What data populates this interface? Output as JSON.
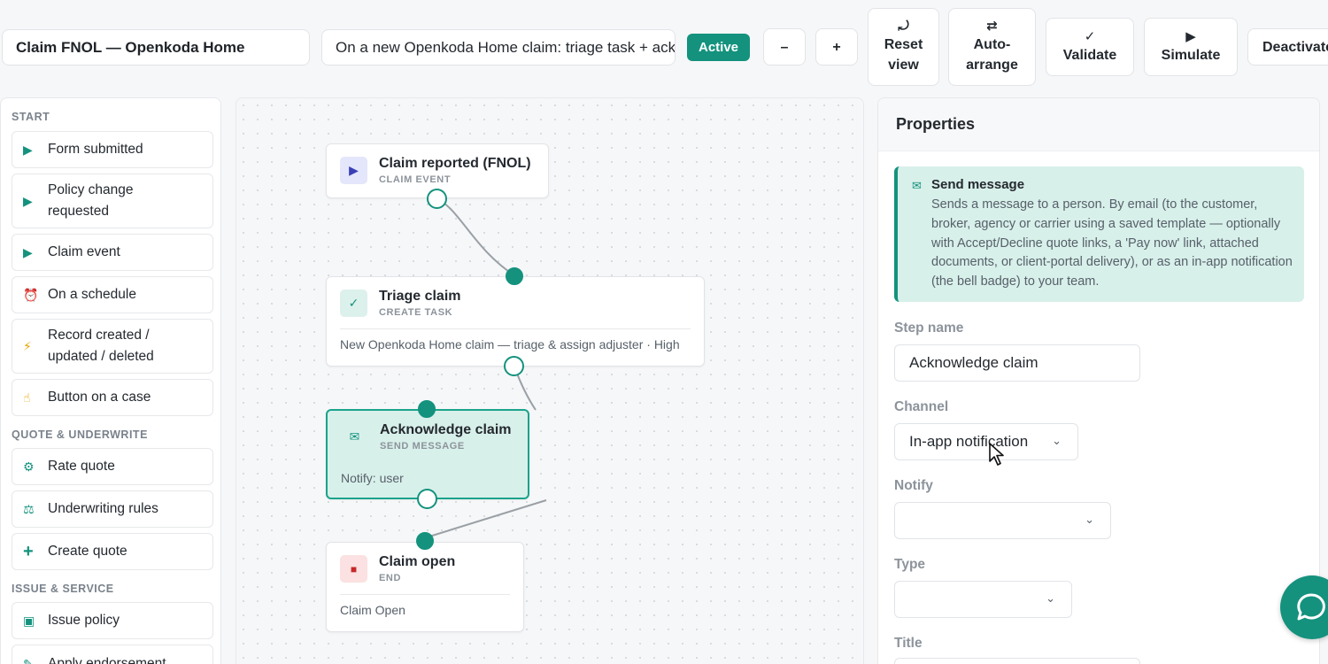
{
  "toolbar": {
    "workflow_name": "Claim FNOL — Openkoda Home",
    "description": "On a new Openkoda Home claim: triage task + acknowledge",
    "status": "Active",
    "zoom_out": "–",
    "zoom_in": "+",
    "reset_icon": "⤾",
    "reset_label": "Reset view",
    "auto_icon": "⇄",
    "auto_label": "Auto-arrange",
    "validate_icon": "✓",
    "validate_label": "Validate",
    "simulate_icon": "▶",
    "simulate_label": "Simulate",
    "deactivate_label": "Deactivate"
  },
  "sidebar": {
    "sections": [
      {
        "label": "START"
      },
      {
        "label": "QUOTE & UNDERWRITE"
      },
      {
        "label": "ISSUE & SERVICE"
      }
    ],
    "items": [
      {
        "icon": "▶",
        "icon_name": "play-icon",
        "label": "Form submitted"
      },
      {
        "icon": "▶",
        "icon_name": "play-icon",
        "label": "Policy change requested"
      },
      {
        "icon": "▶",
        "icon_name": "play-icon",
        "label": "Claim event"
      },
      {
        "icon": "⏰",
        "icon_name": "alarm-clock-icon",
        "label": "On a schedule"
      },
      {
        "icon": "⚡",
        "icon_name": "lightning-icon",
        "label": "Record created / updated / deleted"
      },
      {
        "icon": "☝",
        "icon_name": "pointing-finger-icon",
        "label": "Button on a case"
      },
      {
        "icon": "⚙",
        "icon_name": "gear-icon",
        "label": "Rate quote"
      },
      {
        "icon": "⚖",
        "icon_name": "scales-icon",
        "label": "Underwriting rules"
      },
      {
        "icon": "+",
        "icon_name": "plus-icon",
        "label": "Create quote"
      },
      {
        "icon": "▣",
        "icon_name": "document-icon",
        "label": "Issue policy"
      },
      {
        "icon": "✎",
        "icon_name": "pencil-icon",
        "label": "Apply endorsement"
      }
    ]
  },
  "canvas": {
    "nodes": [
      {
        "title": "Claim reported (FNOL)",
        "subtitle": "CLAIM EVENT",
        "icon": "▶",
        "detail": ""
      },
      {
        "title": "Triage claim",
        "subtitle": "CREATE TASK",
        "icon": "✓",
        "detail": "New Openkoda Home claim — triage & assign adjuster · High"
      },
      {
        "title": "Acknowledge claim",
        "subtitle": "SEND MESSAGE",
        "icon": "✉",
        "detail": "Notify: user"
      },
      {
        "title": "Claim open",
        "subtitle": "END",
        "icon": "■",
        "detail": "Claim Open"
      }
    ]
  },
  "properties": {
    "header": "Properties",
    "info": {
      "icon": "✉",
      "title": "Send message",
      "text": "Sends a message to a person. By email (to the customer, broker, agency or carrier using a saved template — optionally with Accept/Decline quote links, a 'Pay now' link, attached documents, or client-portal delivery), or as an in-app notification (the bell badge) to your team."
    },
    "fields": {
      "step_name_label": "Step name",
      "step_name_value": "Acknowledge claim",
      "channel_label": "Channel",
      "channel_value": "In-app notification",
      "notify_label": "Notify",
      "notify_value": "",
      "type_label": "Type",
      "type_value": "",
      "title_label": "Title"
    },
    "chevron": "⌄"
  },
  "colors": {
    "accent": "#14927e",
    "selected_node_bg": "#d8f0ea",
    "end_node_icon": "#d0342c"
  }
}
